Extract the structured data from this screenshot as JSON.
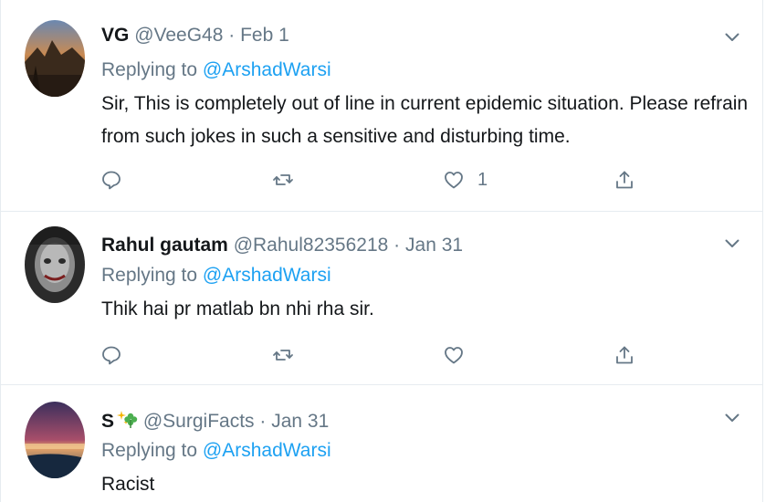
{
  "tweets": [
    {
      "name": "VG",
      "handle": "@VeeG48",
      "separator": "·",
      "date": "Feb 1",
      "replying_prefix": "Replying to",
      "replying_to": "@ArshadWarsi",
      "text_lines": [
        "Sir, This is completely out of line in current epidemic situation. Please refrain",
        "from such jokes in such a sensitive and disturbing time."
      ],
      "like_count": "1",
      "icons": [
        "reply-icon",
        "retweet-icon",
        "heart-icon",
        "share-icon",
        "chevron-down-icon"
      ]
    },
    {
      "name": "Rahul gautam",
      "handle": "@Rahul82356218",
      "separator": "·",
      "date": "Jan 31",
      "replying_prefix": "Replying to",
      "replying_to": "@ArshadWarsi",
      "text_lines": [
        "Thik hai pr matlab bn nhi rha sir."
      ],
      "like_count": "",
      "icons": [
        "reply-icon",
        "retweet-icon",
        "heart-icon",
        "share-icon",
        "chevron-down-icon"
      ]
    },
    {
      "name": "S",
      "handle": "@SurgiFacts",
      "separator": "·",
      "date": "Jan 31",
      "replying_prefix": "Replying to",
      "replying_to": "@ArshadWarsi",
      "text_lines": [
        "Racist"
      ],
      "name_emoji_icon": "sparkles-clover-emoji-icon",
      "icons": [
        "chevron-down-icon"
      ]
    }
  ],
  "colors": {
    "link": "#1da1f2",
    "secondary_text": "#657786",
    "primary_text": "#14171a",
    "divider": "#e6ecf0"
  }
}
